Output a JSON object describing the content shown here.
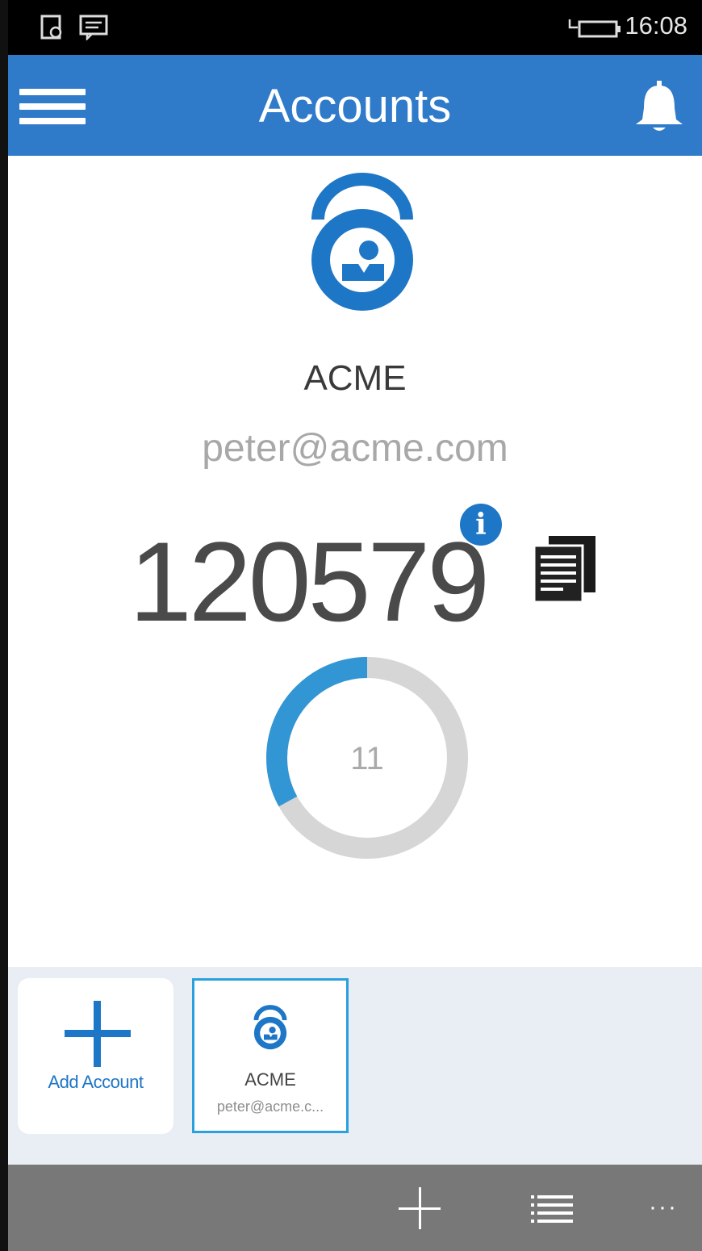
{
  "status": {
    "time": "16:08"
  },
  "header": {
    "title": "Accounts"
  },
  "account": {
    "name": "ACME",
    "email": "peter@acme.com",
    "code": "120579",
    "seconds_remaining": "11",
    "timer_progress_fraction": 0.33
  },
  "tray": {
    "add_label": "Add Account",
    "accounts": [
      {
        "name": "ACME",
        "email": "peter@acme.c..."
      }
    ]
  },
  "colors": {
    "accent": "#2f7bc9",
    "timer_track": "#d6d6d6",
    "timer_fill": "#3196d3",
    "bottom_bar": "#787878"
  },
  "icons": [
    "menu-icon",
    "bell-icon",
    "lock-user-icon",
    "info-icon",
    "copy-icon",
    "add-icon",
    "list-icon",
    "more-icon"
  ]
}
